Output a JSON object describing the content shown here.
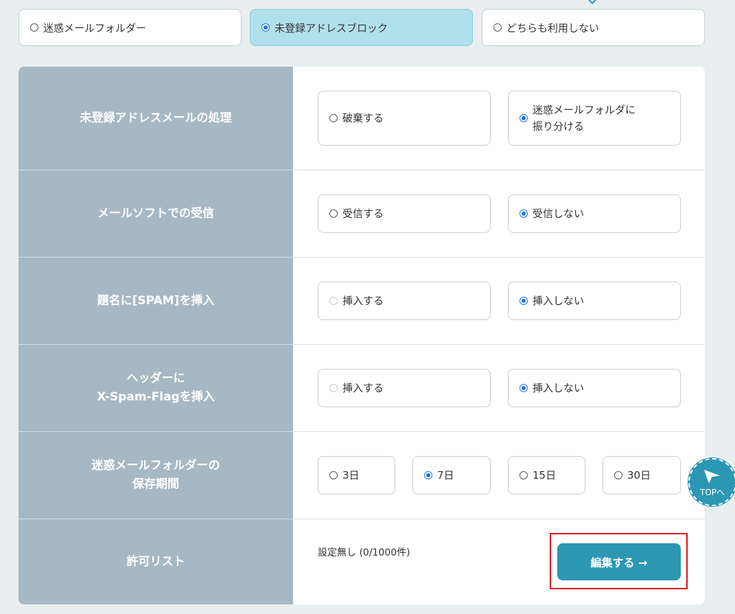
{
  "mode_options": [
    {
      "label": "迷惑メールフォルダー",
      "checked": false
    },
    {
      "label": "未登録アドレスブロック",
      "checked": true
    },
    {
      "label": "どちらも利用しない",
      "checked": false
    }
  ],
  "settings": {
    "unregistered_handling": {
      "label": "未登録アドレスメールの処理",
      "options": [
        {
          "label": "破棄する",
          "checked": false
        },
        {
          "label": "迷惑メールフォルダに\n振り分ける",
          "checked": true
        }
      ]
    },
    "mail_software_receive": {
      "label": "メールソフトでの受信",
      "options": [
        {
          "label": "受信する",
          "checked": false
        },
        {
          "label": "受信しない",
          "checked": true
        }
      ]
    },
    "subject_spam": {
      "label": "題名に[SPAM]を挿入",
      "options": [
        {
          "label": "挿入する",
          "checked": false,
          "disabled": true
        },
        {
          "label": "挿入しない",
          "checked": true
        }
      ]
    },
    "header_flag": {
      "label": "ヘッダーに\nX-Spam-Flagを挿入",
      "options": [
        {
          "label": "挿入する",
          "checked": false,
          "disabled": true
        },
        {
          "label": "挿入しない",
          "checked": true
        }
      ]
    },
    "retention": {
      "label": "迷惑メールフォルダーの\n保存期間",
      "options": [
        {
          "label": "3日",
          "checked": false
        },
        {
          "label": "7日",
          "checked": true
        },
        {
          "label": "15日",
          "checked": false
        },
        {
          "label": "30日",
          "checked": false
        }
      ]
    },
    "allow_list": {
      "label": "許可リスト",
      "status": "設定無し (0/1000件)",
      "edit_label": "編集する →"
    }
  },
  "top_button": {
    "label": "TOPへ"
  },
  "colors": {
    "accent": "#2c97b3",
    "label_bg": "#a6b8c3",
    "selected_bg": "#b0e0ec",
    "highlight": "#d9141c"
  }
}
